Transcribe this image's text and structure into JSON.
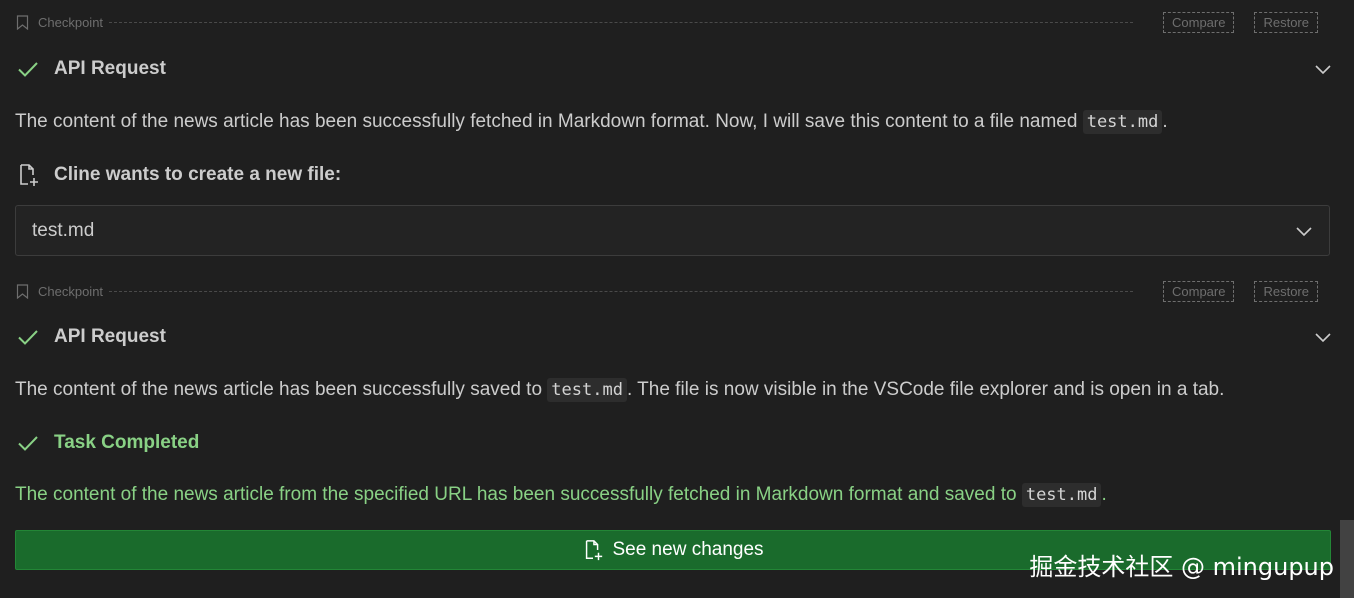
{
  "checkpoints": [
    {
      "label": "Checkpoint",
      "compare": "Compare",
      "restore": "Restore"
    },
    {
      "label": "Checkpoint",
      "compare": "Compare",
      "restore": "Restore"
    }
  ],
  "api_requests": [
    {
      "title": "API Request",
      "status": "success"
    },
    {
      "title": "API Request",
      "status": "success"
    }
  ],
  "messages": {
    "msg1_before": "The content of the news article has been successfully fetched in Markdown format. Now, I will save this content to a file named ",
    "msg1_code": "test.md",
    "msg1_after": ".",
    "msg2_before": "The content of the news article has been successfully saved to ",
    "msg2_code": "test.md",
    "msg2_after": ". The file is now visible in the VSCode file explorer and is open in a tab.",
    "msg3_before": "The content of the news article from the specified URL has been successfully fetched in Markdown format and saved to ",
    "msg3_code": "test.md",
    "msg3_after": "."
  },
  "create_file": {
    "heading": "Cline wants to create a new file:",
    "filename": "test.md"
  },
  "task_completed": {
    "title": "Task Completed"
  },
  "see_changes": {
    "label": "See new changes"
  },
  "watermark": "掘金技术社区 @ mingupup",
  "colors": {
    "success": "#89d185",
    "button_bg": "#1a6b2c",
    "background": "#1f1f1f"
  },
  "icons": [
    "bookmark-icon",
    "check-icon",
    "chevron-down-icon",
    "new-file-icon"
  ]
}
